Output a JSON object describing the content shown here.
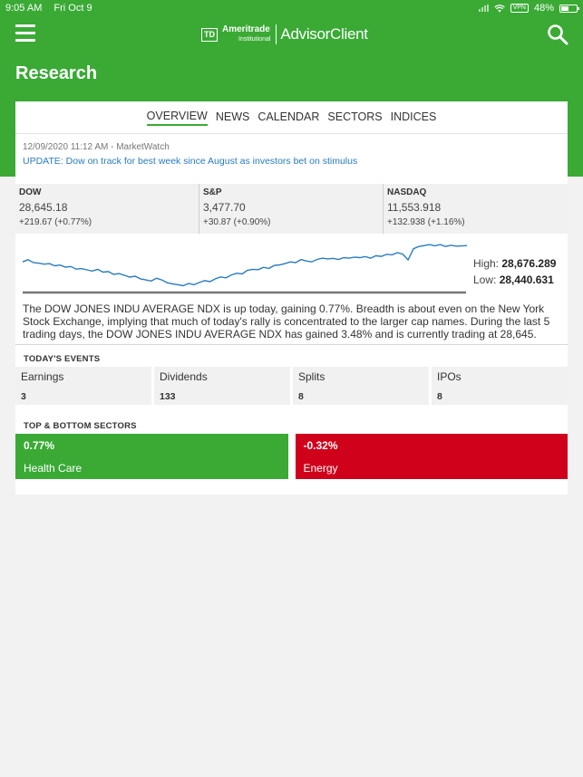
{
  "status_bar": {
    "time": "9:05 AM",
    "date": "Fri Oct 9",
    "vpn": "VPN",
    "battery": "48%"
  },
  "header": {
    "logo_mark": "TD",
    "brand_name": "Ameritrade",
    "brand_sub": "Institutional",
    "product_name": "AdvisorClient",
    "page_title": "Research",
    "brand_color": "#3aaa35"
  },
  "tabs": [
    {
      "label": "OVERVIEW",
      "active": true
    },
    {
      "label": "NEWS",
      "active": false
    },
    {
      "label": "CALENDAR",
      "active": false
    },
    {
      "label": "SECTORS",
      "active": false
    },
    {
      "label": "INDICES",
      "active": false
    }
  ],
  "news": {
    "meta": "12/09/2020 11:12 AM - MarketWatch",
    "headline": "UPDATE: Dow on track for best week since August as investors bet on stimulus"
  },
  "indices": [
    {
      "name": "DOW",
      "value": "28,645.18",
      "change": "+219.67 (+0.77%)"
    },
    {
      "name": "S&P",
      "value": "3,477.70",
      "change": "+30.87 (+0.90%)"
    },
    {
      "name": "NASDAQ",
      "value": "11,553.918",
      "change": "+132.938 (+1.16%)"
    }
  ],
  "chart": {
    "type": "line",
    "line_color": "#2a7bbf",
    "high_label": "High:",
    "high_value": "28,676.289",
    "low_label": "Low:",
    "low_value": "28,440.631",
    "ylim": [
      28440.631,
      28676.289
    ],
    "values": [
      28578,
      28590,
      28574,
      28571,
      28565,
      28568,
      28556,
      28560,
      28548,
      28552,
      28537,
      28540,
      28533,
      28526,
      28536,
      28520,
      28523,
      28507,
      28512,
      28502,
      28492,
      28497,
      28482,
      28476,
      28470,
      28485,
      28476,
      28460,
      28454,
      28449,
      28443,
      28456,
      28449,
      28461,
      28472,
      28466,
      28482,
      28493,
      28488,
      28504,
      28514,
      28510,
      28531,
      28536,
      28534,
      28547,
      28541,
      28558,
      28561,
      28568,
      28578,
      28574,
      28591,
      28583,
      28578,
      28592,
      28599,
      28595,
      28598,
      28592,
      28602,
      28599,
      28605,
      28602,
      28608,
      28599,
      28613,
      28609,
      28621,
      28618,
      28630,
      28622,
      28589,
      28652,
      28665,
      28670,
      28676,
      28669,
      28676,
      28665,
      28672,
      28667,
      28668,
      28670
    ]
  },
  "summary": "The DOW JONES INDU AVERAGE NDX is up today, gaining 0.77%. Breadth is about even on the New York Stock Exchange, implying that much of today's rally is concentrated to the larger cap names. During the last 5 trading days, the DOW JONES INDU AVERAGE NDX has gained 3.48% and is currently trading at 28,645.",
  "events": {
    "title": "TODAY'S EVENTS",
    "items": [
      {
        "label": "Earnings",
        "count": "3"
      },
      {
        "label": "Dividends",
        "count": "133"
      },
      {
        "label": "Splits",
        "count": "8"
      },
      {
        "label": "IPOs",
        "count": "8"
      }
    ]
  },
  "sectors": {
    "title": "TOP & BOTTOM SECTORS",
    "top": {
      "pct": "0.77%",
      "name": "Health Care",
      "color": "#3aaa35"
    },
    "bottom": {
      "pct": "-0.32%",
      "name": "Energy",
      "color": "#d0021b"
    }
  }
}
